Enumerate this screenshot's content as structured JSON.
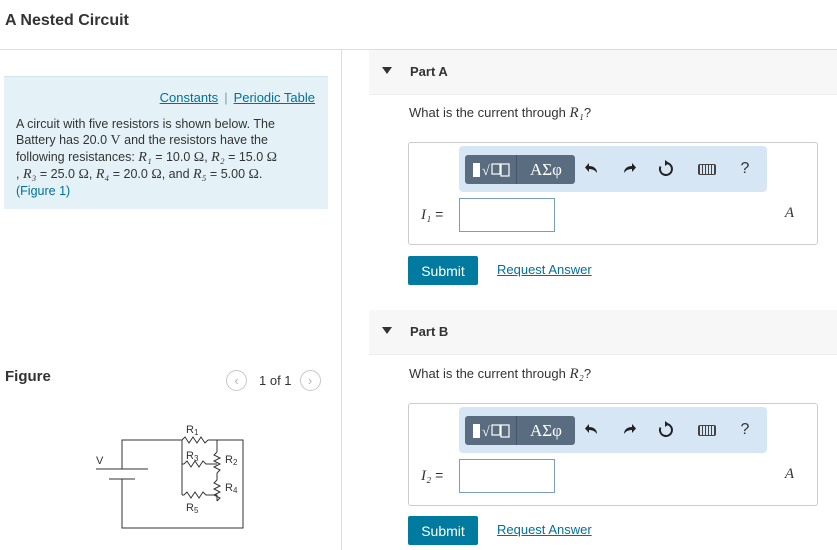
{
  "page": {
    "title": "A Nested Circuit"
  },
  "info": {
    "constants_link": "Constants",
    "separator": "|",
    "periodic_table_link": "Periodic Table",
    "line1": "A circuit with five resistors is shown below. The",
    "line2_pre": "Battery has 20.0",
    "line2_unit": "V",
    "line2_post": "and the resistors have the",
    "line3_pre": "following resistances:",
    "r1_sym": "R₁",
    "r1_val": "= 10.0",
    "ohm": "Ω",
    "r2_sym": "R₂",
    "r2_val": "= 15.0",
    "r3_sym": "R₃",
    "r3_val": "= 25.0",
    "r4_sym": "R₄",
    "r4_val": "= 20.0",
    "and": ", and",
    "r5_sym": "R₅",
    "r5_val": "= 5.00",
    "figure_ref": "(Figure 1)"
  },
  "figure": {
    "heading": "Figure",
    "prev_icon": "chevron-left-icon",
    "next_icon": "chevron-right-icon",
    "pager_text": "1 of 1",
    "labels": {
      "r1": "R",
      "r1_sub": "1",
      "r2": "R",
      "r2_sub": "2",
      "r3": "R",
      "r3_sub": "3",
      "r4": "R",
      "r4_sub": "4",
      "r5": "R",
      "r5_sub": "5",
      "v": "V"
    }
  },
  "parts": [
    {
      "label": "Part A",
      "question_pre": "What is the current through",
      "question_sym": "R₁",
      "question_post": "?",
      "var_sym": "I₁",
      "equals": "=",
      "unit": "A",
      "input_value": "",
      "submit": "Submit",
      "request": "Request Answer"
    },
    {
      "label": "Part B",
      "question_pre": "What is the current through",
      "question_sym": "R₂",
      "question_post": "?",
      "var_sym": "I₂",
      "equals": "=",
      "unit": "A",
      "input_value": "",
      "submit": "Submit",
      "request": "Request Answer"
    }
  ],
  "toolbar": {
    "greek": "AΣφ",
    "help": "?",
    "icons": [
      "templates-icon",
      "greek-symbols-icon",
      "undo-icon",
      "redo-icon",
      "reset-icon",
      "keyboard-icon",
      "help-icon"
    ]
  },
  "colors": {
    "accent": "#007a9e",
    "link": "#007099",
    "info_bg": "#e4f2f8",
    "toolbar_bg": "#d6e6f5"
  }
}
